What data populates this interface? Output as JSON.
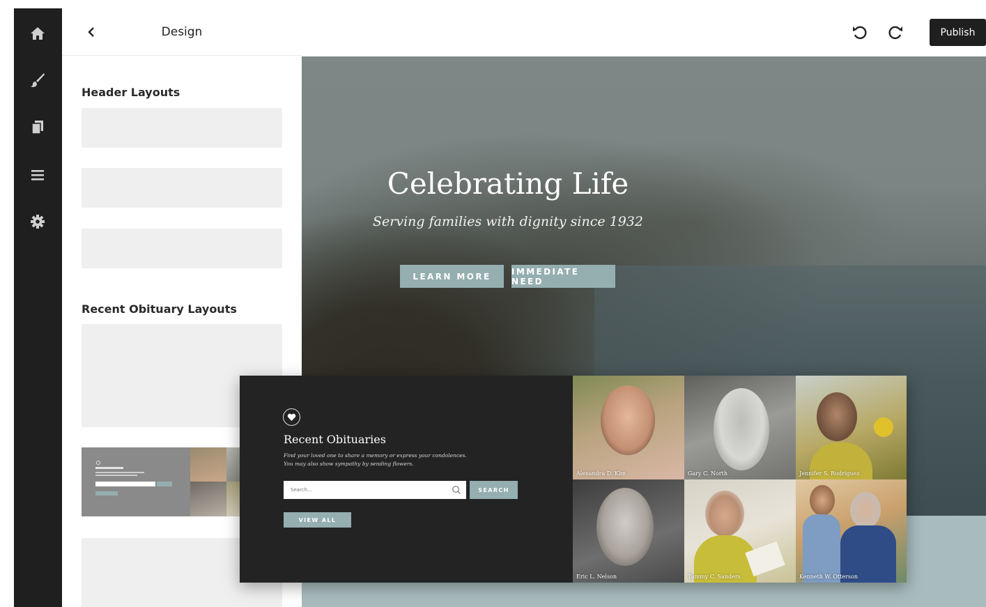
{
  "sidebar_rail": {
    "items": [
      {
        "icon": "home-icon"
      },
      {
        "icon": "brush-icon"
      },
      {
        "icon": "pages-icon"
      },
      {
        "icon": "menu-icon"
      },
      {
        "icon": "settings-icon"
      }
    ]
  },
  "panel": {
    "back_icon": "chevron-left-icon",
    "title": "Design",
    "sections": [
      {
        "title": "Header Layouts"
      },
      {
        "title": "Recent Obituary Layouts"
      }
    ]
  },
  "toolbar": {
    "undo_icon": "undo-icon",
    "redo_icon": "redo-icon",
    "publish_label": "Publish"
  },
  "hero": {
    "title": "Celebrating Life",
    "subtitle": "Serving families with dignity since 1932",
    "primary_button": "LEARN MORE",
    "secondary_button": "IMMEDIATE NEED"
  },
  "obituaries": {
    "title": "Recent Obituaries",
    "description_line1": "Find your loved one to share a memory or express your condolences.",
    "description_line2": "You may also show sympathy by sending flowers.",
    "search_placeholder": "Search...",
    "search_button": "SEARCH",
    "view_all_button": "VIEW ALL",
    "people": [
      {
        "name": "Alexandra D. Kim"
      },
      {
        "name": "Gary C. North"
      },
      {
        "name": "Jennifer S. Rodriguez"
      },
      {
        "name": "Eric L. Nelson"
      },
      {
        "name": "Tammy C. Sanders"
      },
      {
        "name": "Kenneth W. Otterson"
      }
    ]
  },
  "colors": {
    "rail": "#1f1f1f",
    "accent": "#95aeb0",
    "publish": "#1f1f1f",
    "card": "#232323"
  }
}
